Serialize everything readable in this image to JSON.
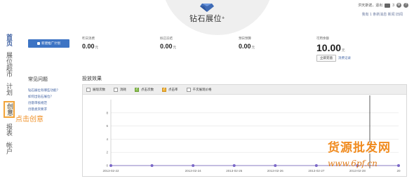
{
  "header": {
    "title": "钻石展位",
    "title_sup": "+",
    "user_greeting": "洪天斯诺，退出",
    "msg_count": "3",
    "sub_links": "我有 1 条新消息 新闻 旧闻"
  },
  "sidebar": {
    "items": [
      {
        "label": "首页"
      },
      {
        "label": "展位超市"
      },
      {
        "label": "计划"
      },
      {
        "label": "创意"
      },
      {
        "label": "报表"
      },
      {
        "label": "帐户"
      }
    ],
    "callout": "点击创意"
  },
  "toolbar": {
    "new_plan_label": "新建推广计划"
  },
  "stats": [
    {
      "label": "昨日消费",
      "value": "0.00",
      "unit": "元"
    },
    {
      "label": "拟已冻结",
      "value": "0.00",
      "unit": "元"
    },
    {
      "label": "预日预算",
      "value": "0.00",
      "unit": "元"
    },
    {
      "label": "可用余额",
      "value": "10.00",
      "unit": "元"
    }
  ],
  "balance_actions": {
    "recharge_label": "立即充值",
    "records_label": "消费记录"
  },
  "faq": {
    "title": "常见问题",
    "questions": [
      "钻石展位有哪些功能？",
      "如何出钻石展位？",
      "创意审核规范",
      "创意类资要求"
    ]
  },
  "chart_section": {
    "title": "投放效果",
    "legend": [
      {
        "label": "展现次数",
        "checked": false
      },
      {
        "label": "消耗",
        "checked": false
      },
      {
        "label": "点击次数",
        "checked": true,
        "color": "#8cc152"
      },
      {
        "label": "点击率",
        "checked": true,
        "color": "#f0b33c"
      },
      {
        "label": "千次展现价格",
        "checked": false
      }
    ]
  },
  "chart_data": {
    "type": "line",
    "title": "",
    "xlabel": "",
    "ylabel": "",
    "x": [
      "2013-02-22",
      "2013-02-23",
      "2013-02-24",
      "2013-02-25",
      "2013-02-26",
      "2013-02-27",
      "2013-02-28",
      "2013-03-01"
    ],
    "x_tick_labels": [
      "2013-02-22",
      "2013-02-24",
      "2013-02-25",
      "2013-02-26",
      "2013-02-27",
      "2013-02-28",
      "20"
    ],
    "y_ticks": [
      0,
      2,
      4,
      6,
      8
    ],
    "ylim": [
      0,
      10
    ],
    "series": [
      {
        "name": "点击次数",
        "values": [
          0,
          0,
          0,
          0,
          0,
          0,
          0,
          0
        ],
        "color": "#7b68c8"
      }
    ],
    "grid": true
  },
  "watermark": {
    "main": "货源批发网",
    "url": "www.6pf.cn"
  }
}
